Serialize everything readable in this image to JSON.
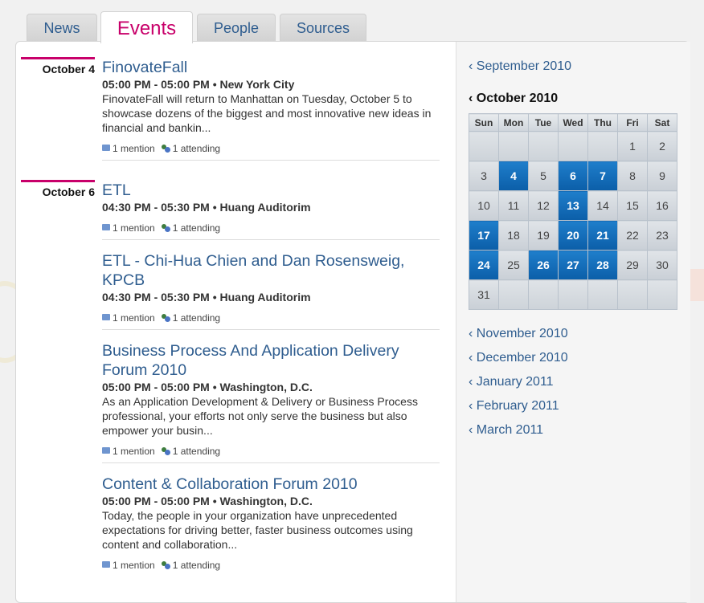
{
  "tabs": [
    {
      "label": "News"
    },
    {
      "label": "Events"
    },
    {
      "label": "People"
    },
    {
      "label": "Sources"
    }
  ],
  "days": [
    {
      "date": "October 4"
    },
    {
      "date": "October 6"
    }
  ],
  "events": [
    {
      "title": "FinovateFall",
      "meta": "05:00 PM - 05:00 PM • New York City",
      "desc": "FinovateFall will return to Manhattan on Tuesday, October 5 to showcase dozens of the biggest and most innovative new ideas in financial and bankin...",
      "mentions": "1 mention",
      "attending": "1 attending"
    },
    {
      "title": "ETL",
      "meta": "04:30 PM - 05:30 PM • Huang Auditorim",
      "desc": "",
      "mentions": "1 mention",
      "attending": "1 attending"
    },
    {
      "title": "ETL - Chi-Hua Chien and Dan Rosensweig, KPCB",
      "meta": "04:30 PM - 05:30 PM • Huang Auditorim",
      "desc": "",
      "mentions": "1 mention",
      "attending": "1 attending"
    },
    {
      "title": "Business Process And Application Delivery Forum 2010",
      "meta": "05:00 PM - 05:00 PM • Washington, D.C.",
      "desc": "As an Application Development & Delivery or Business Process professional, your efforts not only serve the business but also empower your busin...",
      "mentions": "1 mention",
      "attending": "1 attending"
    },
    {
      "title": "Content & Collaboration Forum 2010",
      "meta": "05:00 PM - 05:00 PM • Washington, D.C.",
      "desc": "Today, the people in your organization have unprecedented expectations for driving better, faster business outcomes using content and collaboration...",
      "mentions": "1 mention",
      "attending": "1 attending"
    }
  ],
  "sidebar": {
    "prev_month": "‹ September 2010",
    "current_month": "‹ October 2010",
    "next_months": [
      "‹ November 2010",
      "‹ December 2010",
      "‹ January 2011",
      "‹ February 2011",
      "‹ March 2011"
    ]
  },
  "calendar": {
    "weekdays": [
      "Sun",
      "Mon",
      "Tue",
      "Wed",
      "Thu",
      "Fri",
      "Sat"
    ],
    "weeks": [
      [
        "",
        "",
        "",
        "",
        "",
        "1",
        "2"
      ],
      [
        "3",
        "4",
        "5",
        "6",
        "7",
        "8",
        "9"
      ],
      [
        "10",
        "11",
        "12",
        "13",
        "14",
        "15",
        "16"
      ],
      [
        "17",
        "18",
        "19",
        "20",
        "21",
        "22",
        "23"
      ],
      [
        "24",
        "25",
        "26",
        "27",
        "28",
        "29",
        "30"
      ],
      [
        "31",
        "",
        "",
        "",
        "",
        "",
        ""
      ]
    ],
    "event_days": [
      "4",
      "6",
      "7",
      "13",
      "17",
      "20",
      "21",
      "24",
      "26",
      "27",
      "28"
    ],
    "highlight_color": "#0b5ea8"
  },
  "colors": {
    "accent": "#c8006a",
    "link": "#2f5d8f"
  }
}
